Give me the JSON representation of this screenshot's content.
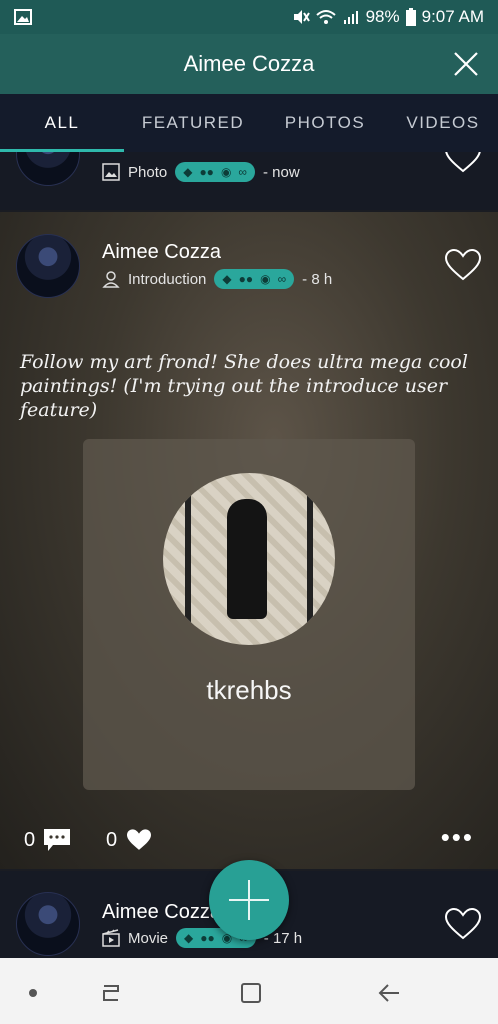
{
  "status_bar": {
    "battery": "98%",
    "time": "9:07 AM"
  },
  "header": {
    "title": "Aimee Cozza"
  },
  "tabs": [
    {
      "label": "ALL",
      "active": true
    },
    {
      "label": "FEATURED"
    },
    {
      "label": "PHOTOS"
    },
    {
      "label": "VIDEOS"
    }
  ],
  "feed": {
    "top_item": {
      "type_label": "Photo",
      "time": "- now"
    },
    "post": {
      "author": "Aimee Cozza",
      "type_label": "Introduction",
      "time": "- 8 h",
      "text": "Follow my art frond! She does ultra mega cool paintings! (I'm trying out the introduce user feature)",
      "introduced_user": "tkrehbs",
      "comments": "0",
      "likes": "0"
    },
    "bottom_item": {
      "author": "Aimee Cozza",
      "type_label": "Movie",
      "time": "- 17 h"
    }
  },
  "colors": {
    "header": "#24605b",
    "accent": "#2aa79c",
    "tabs_bg": "#141b2b"
  }
}
